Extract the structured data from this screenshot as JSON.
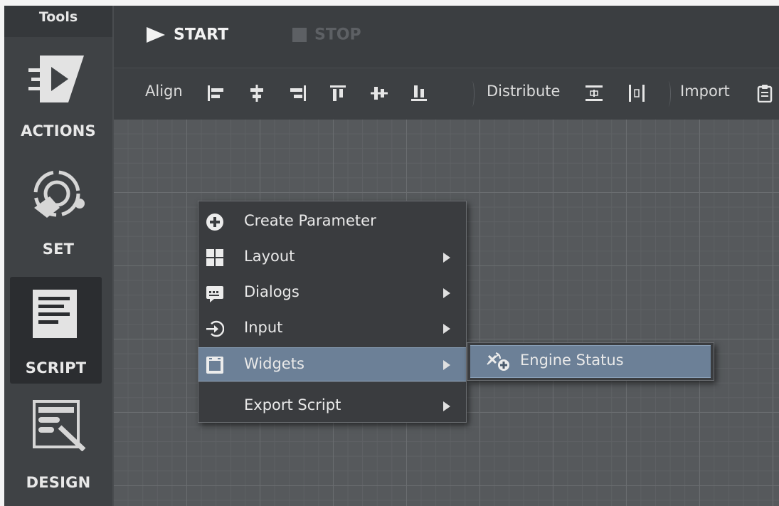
{
  "rail": {
    "title": "Tools",
    "tools": {
      "actions": "ACTIONS",
      "set": "SET",
      "script": "SCRIPT",
      "design": "DESIGN"
    },
    "selected": "script"
  },
  "runbar": {
    "start_label": "START",
    "stop_label": "STOP"
  },
  "alignbar": {
    "align_label": "Align",
    "distribute_label": "Distribute",
    "import_label": "Import",
    "icons": [
      "align-left-icon",
      "align-center-h-icon",
      "align-right-icon",
      "align-top-icon",
      "align-middle-v-icon",
      "align-bottom-icon",
      "distribute-vertical-icon",
      "distribute-horizontal-icon",
      "clipboard-icon"
    ]
  },
  "context_menu": {
    "items": [
      {
        "label": "Create Parameter",
        "icon": "plus-circle-icon",
        "submenu": false
      },
      {
        "label": "Layout",
        "icon": "grid-icon",
        "submenu": true
      },
      {
        "label": "Dialogs",
        "icon": "dialog-icon",
        "submenu": true
      },
      {
        "label": "Input",
        "icon": "input-icon",
        "submenu": true
      },
      {
        "label": "Widgets",
        "icon": "widget-icon",
        "submenu": true
      },
      {
        "label": "Export Script",
        "icon": "",
        "submenu": true
      }
    ],
    "selected": "Widgets"
  },
  "submenu": {
    "items": [
      {
        "label": "Engine Status",
        "icon": "satellite-add-icon"
      }
    ]
  },
  "colors": {
    "rail_bg": "#3f4245",
    "canvas_bg": "#56595c",
    "menu_bg": "#3a3c3f",
    "selection": "#6c8097"
  }
}
